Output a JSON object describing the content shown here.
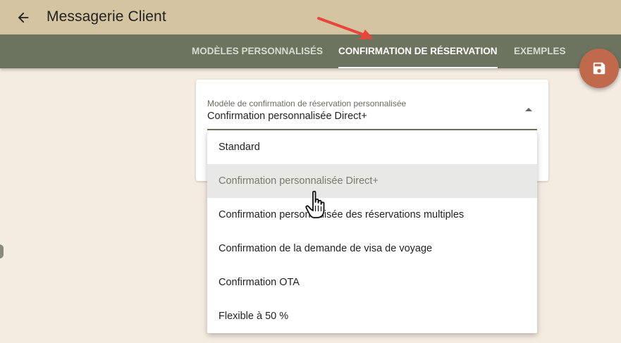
{
  "header": {
    "title": "Messagerie Client",
    "back_icon": "arrow-left-icon",
    "background_color": "#d5c4a1"
  },
  "tabs": {
    "background_color": "#6c7460",
    "items": [
      {
        "label": "MODÈLES PERSONNALISÉS",
        "active": false
      },
      {
        "label": "CONFIRMATION DE RÉSERVATION",
        "active": true
      },
      {
        "label": "EXEMPLES",
        "active": false
      }
    ]
  },
  "fab": {
    "icon": "save-icon",
    "color": "#c0694c"
  },
  "select": {
    "label": "Modèle de confirmation de réservation personnalisée",
    "value": "Confirmation personnalisée Direct+"
  },
  "dropdown": {
    "options": [
      {
        "label": "Standard",
        "hovered": false
      },
      {
        "label": "Confirmation personnalisée Direct+",
        "hovered": true
      },
      {
        "label": "Confirmation personnalisée des réservations multiples",
        "hovered": false
      },
      {
        "label": "Confirmation de la demande de visa de voyage",
        "hovered": false
      },
      {
        "label": "Confirmation OTA",
        "hovered": false
      },
      {
        "label": "Flexible à 50 %",
        "hovered": false
      }
    ]
  },
  "annotation": {
    "arrow_color": "#e8463c"
  }
}
